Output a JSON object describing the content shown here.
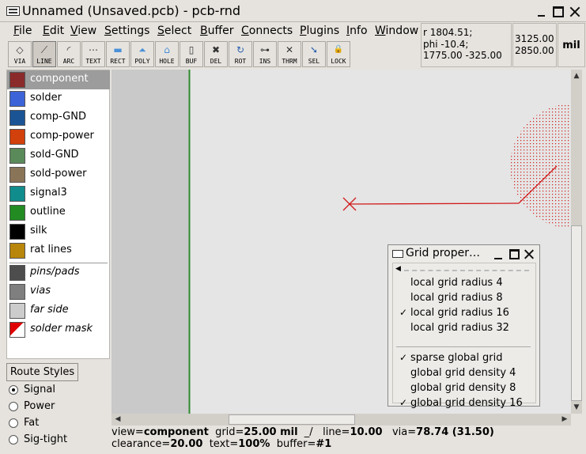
{
  "window": {
    "title": "Unnamed (Unsaved.pcb) - pcb-rnd"
  },
  "menu": [
    "File",
    "Edit",
    "View",
    "Settings",
    "Select",
    "Buffer",
    "Connects",
    "Plugins",
    "Info",
    "Window"
  ],
  "tools": [
    {
      "label": "VIA",
      "icon": "via-icon",
      "glyph": "◇"
    },
    {
      "label": "LINE",
      "icon": "line-icon",
      "glyph": "⟋"
    },
    {
      "label": "ARC",
      "icon": "arc-icon",
      "glyph": "◜"
    },
    {
      "label": "TEXT",
      "icon": "text-icon",
      "glyph": "⋯"
    },
    {
      "label": "RECT",
      "icon": "rect-icon",
      "glyph": "▬"
    },
    {
      "label": "POLY",
      "icon": "poly-icon",
      "glyph": "⏶"
    },
    {
      "label": "HOLE",
      "icon": "hole-icon",
      "glyph": "⌂"
    },
    {
      "label": "BUF",
      "icon": "buffer-icon",
      "glyph": "▯"
    },
    {
      "label": "DEL",
      "icon": "delete-icon",
      "glyph": "✖"
    },
    {
      "label": "ROT",
      "icon": "rotate-icon",
      "glyph": "↻"
    },
    {
      "label": "INS",
      "icon": "insert-icon",
      "glyph": "⊶"
    },
    {
      "label": "THRM",
      "icon": "thermal-icon",
      "glyph": "✕"
    },
    {
      "label": "SEL",
      "icon": "select-icon",
      "glyph": "➘"
    },
    {
      "label": "LOCK",
      "icon": "lock-icon",
      "glyph": "🔒"
    }
  ],
  "active_tool": "LINE",
  "readout": {
    "line1": "r 1804.51;",
    "line2": "phi -10.4;",
    "line3": "1775.00 -325.00",
    "abs_x": "3125.00",
    "abs_y": "2850.00",
    "unit": "mil"
  },
  "layers": [
    {
      "name": "component",
      "color": "#8b2a2a",
      "selected": true,
      "italic": false
    },
    {
      "name": "solder",
      "color": "#3c64d8",
      "selected": false,
      "italic": false
    },
    {
      "name": "comp-GND",
      "color": "#1a5494",
      "selected": false,
      "italic": false
    },
    {
      "name": "comp-power",
      "color": "#d2400c",
      "selected": false,
      "italic": false
    },
    {
      "name": "sold-GND",
      "color": "#5a8a5a",
      "selected": false,
      "italic": false
    },
    {
      "name": "sold-power",
      "color": "#8a7458",
      "selected": false,
      "italic": false
    },
    {
      "name": "signal3",
      "color": "#118c8c",
      "selected": false,
      "italic": false
    },
    {
      "name": "outline",
      "color": "#228b22",
      "selected": false,
      "italic": false
    },
    {
      "name": "silk",
      "color": "#000000",
      "selected": false,
      "italic": false
    },
    {
      "name": "rat lines",
      "color": "#b8860b",
      "selected": false,
      "italic": false
    },
    {
      "name": "pins/pads",
      "color": "#4d4d4d",
      "selected": false,
      "italic": true
    },
    {
      "name": "vias",
      "color": "#7f7f7f",
      "selected": false,
      "italic": true
    },
    {
      "name": "far side",
      "color": "#cccccc",
      "selected": false,
      "italic": true
    },
    {
      "name": "solder mask",
      "color": "#ffffff",
      "selected": false,
      "italic": true
    }
  ],
  "route_styles": {
    "button": "Route Styles",
    "options": [
      "Signal",
      "Power",
      "Fat",
      "Sig-tight"
    ],
    "selected": "Signal"
  },
  "status": {
    "view_k": "view=",
    "view_v": "component",
    "grid_k": "grid=",
    "grid_v": "25.00 mil",
    "snap": "_/",
    "line_k": "line=",
    "line_v": "10.00",
    "via_k": "via=",
    "via_v": "78.74 (31.50)",
    "clear_k": "clearance=",
    "clear_v": "20.00",
    "text_k": "text=",
    "text_v": "100%",
    "buffer_k": "buffer=",
    "buffer_v": "#1"
  },
  "grid_popup": {
    "title": "Grid proper…",
    "items": [
      {
        "label": "local grid radius 4",
        "checked": false
      },
      {
        "label": "local grid radius 8",
        "checked": false
      },
      {
        "label": "local grid radius 16",
        "checked": true
      },
      {
        "label": "local grid radius 32",
        "checked": false
      },
      {
        "label": "sparse global grid",
        "checked": true
      },
      {
        "label": "global grid density 4",
        "checked": false
      },
      {
        "label": "global grid density 8",
        "checked": false
      },
      {
        "label": "global grid density 16",
        "checked": true
      }
    ],
    "check_glyph": "✓"
  },
  "colors": {
    "outline_line": "#2e8b2e",
    "trace": "#d11a1a",
    "far_area": "#c9c9c9"
  }
}
